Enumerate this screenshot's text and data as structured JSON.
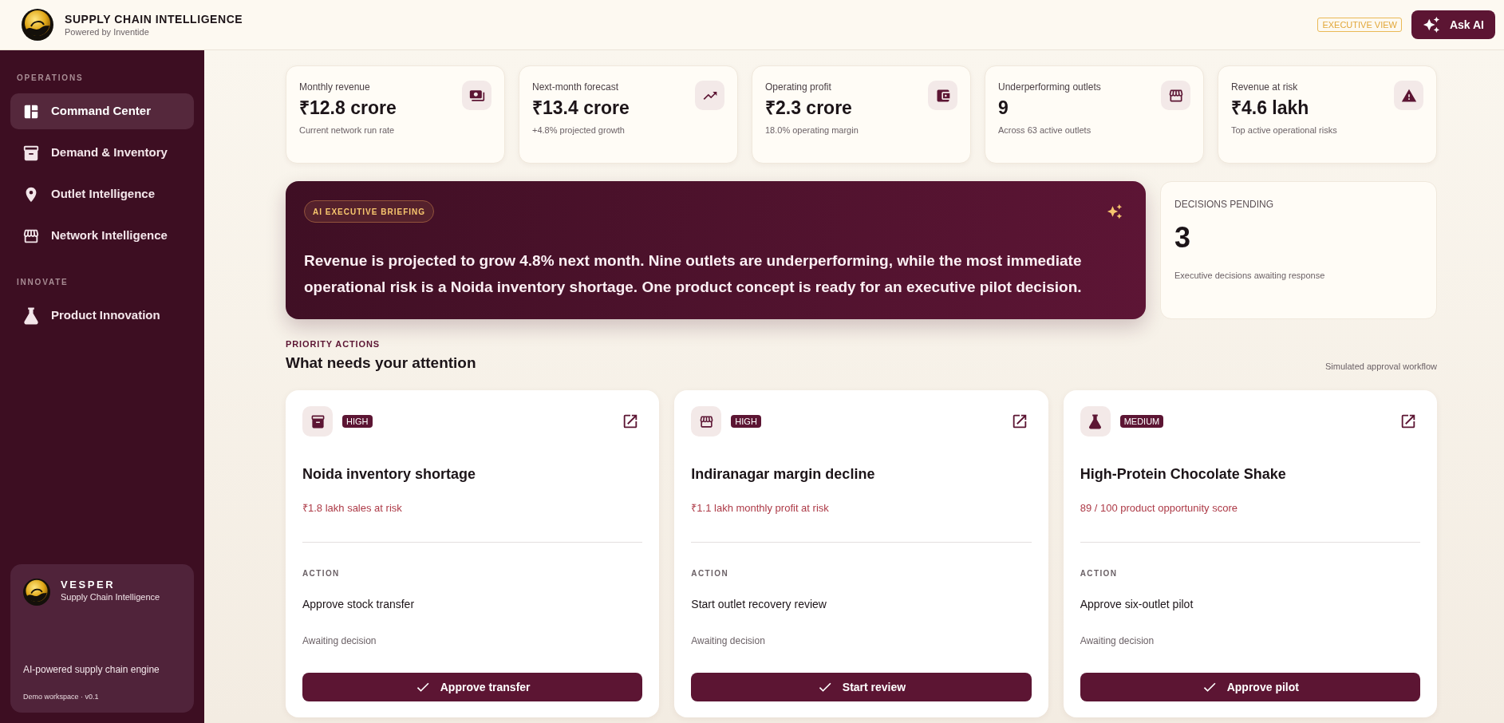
{
  "header": {
    "title": "SUPPLY CHAIN INTELLIGENCE",
    "subtitle": "Powered by Inventide",
    "view_badge": "EXECUTIVE VIEW",
    "ask_button": "Ask AI"
  },
  "sidebar": {
    "sections": [
      {
        "label": "OPERATIONS",
        "items": [
          {
            "label": "Command Center",
            "selected": true
          },
          {
            "label": "Demand & Inventory",
            "selected": false
          },
          {
            "label": "Outlet Intelligence",
            "selected": false
          },
          {
            "label": "Network Intelligence",
            "selected": false
          }
        ]
      },
      {
        "label": "INNOVATE",
        "items": [
          {
            "label": "Product Innovation",
            "selected": false
          }
        ]
      }
    ],
    "footer": {
      "name": "VESPER",
      "subtitle": "Supply Chain Intelligence",
      "tagline": "AI-powered supply chain engine",
      "version": "Demo workspace · v0.1"
    }
  },
  "kpis": [
    {
      "label": "Monthly revenue",
      "value": "₹12.8 crore",
      "note": "Current network run rate"
    },
    {
      "label": "Next-month forecast",
      "value": "₹13.4 crore",
      "note": "+4.8% projected growth"
    },
    {
      "label": "Operating profit",
      "value": "₹2.3 crore",
      "note": "18.0% operating margin"
    },
    {
      "label": "Underperforming outlets",
      "value": "9",
      "note": "Across 63 active outlets"
    },
    {
      "label": "Revenue at risk",
      "value": "₹4.6 lakh",
      "note": "Top active operational risks"
    }
  ],
  "briefing": {
    "badge": "AI EXECUTIVE BRIEFING",
    "text": "Revenue is projected to grow 4.8% next month. Nine outlets are underperforming, while the most immediate operational risk is a Noida inventory shortage. One product concept is ready for an executive pilot decision."
  },
  "decisions": {
    "label": "DECISIONS PENDING",
    "count": "3",
    "note": "Executive decisions awaiting response"
  },
  "priority": {
    "eyebrow": "PRIORITY ACTIONS",
    "heading": "What needs your attention",
    "note": "Simulated approval workflow",
    "cards": [
      {
        "priority": "HIGH",
        "title": "Noida inventory shortage",
        "impact": "₹1.8 lakh sales at risk",
        "action_label": "ACTION",
        "action": "Approve stock transfer",
        "status": "Awaiting decision",
        "button": "Approve transfer"
      },
      {
        "priority": "HIGH",
        "title": "Indiranagar margin decline",
        "impact": "₹1.1 lakh monthly profit at risk",
        "action_label": "ACTION",
        "action": "Start outlet recovery review",
        "status": "Awaiting decision",
        "button": "Start review"
      },
      {
        "priority": "MEDIUM",
        "title": "High-Protein Chocolate Shake",
        "impact": "89 / 100 product opportunity score",
        "action_label": "ACTION",
        "action": "Approve six-outlet pilot",
        "status": "Awaiting decision",
        "button": "Approve pilot"
      }
    ]
  }
}
